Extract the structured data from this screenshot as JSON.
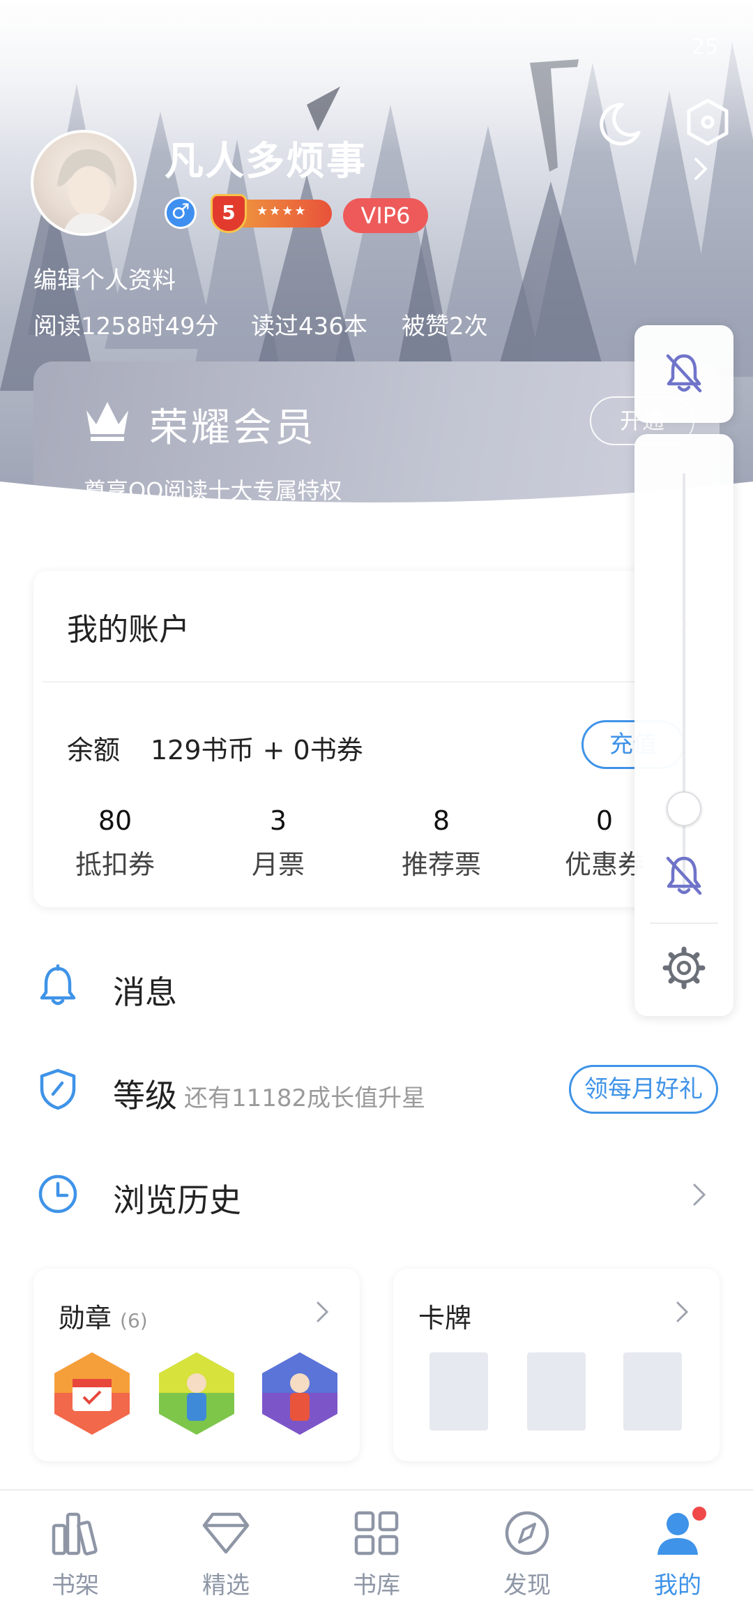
{
  "status": {
    "battery": "25"
  },
  "profile": {
    "username": "凡人多烦事",
    "gender_symbol": "♂",
    "level": "5",
    "level_stars": "★★★★",
    "vip": "VIP6",
    "edit_label": "编辑个人资料",
    "stats": [
      "阅读1258时49分",
      "读过436本",
      "被赞2次"
    ]
  },
  "vip_card": {
    "title": "荣耀会员",
    "subtitle": "尊享QQ阅读十大专属特权",
    "open_label": "开通"
  },
  "account": {
    "title": "我的账户",
    "balance_label": "余额",
    "balance_value": "129书币 + 0书券",
    "recharge_label": "充值",
    "tickets": [
      {
        "value": "80",
        "label": "抵扣券"
      },
      {
        "value": "3",
        "label": "月票"
      },
      {
        "value": "8",
        "label": "推荐票"
      },
      {
        "value": "0",
        "label": "优惠券"
      }
    ]
  },
  "menu": {
    "messages": {
      "label": "消息"
    },
    "level": {
      "label": "等级",
      "hint": "还有11182成长值升星",
      "button": "领每月好礼"
    },
    "history": {
      "label": "浏览历史"
    }
  },
  "cards": {
    "medals": {
      "title": "勋章",
      "count": "(6)"
    },
    "cardbrand": {
      "title": "卡牌"
    }
  },
  "tabs": [
    {
      "label": "书架",
      "icon": "bookshelf-icon"
    },
    {
      "label": "精选",
      "icon": "diamond-icon"
    },
    {
      "label": "书库",
      "icon": "grid-icon"
    },
    {
      "label": "发现",
      "icon": "compass-icon"
    },
    {
      "label": "我的",
      "icon": "user-icon"
    }
  ],
  "colors": {
    "accent": "#3f93e8",
    "vip_red": "#ee5a5a",
    "notification_red": "#f04848"
  }
}
